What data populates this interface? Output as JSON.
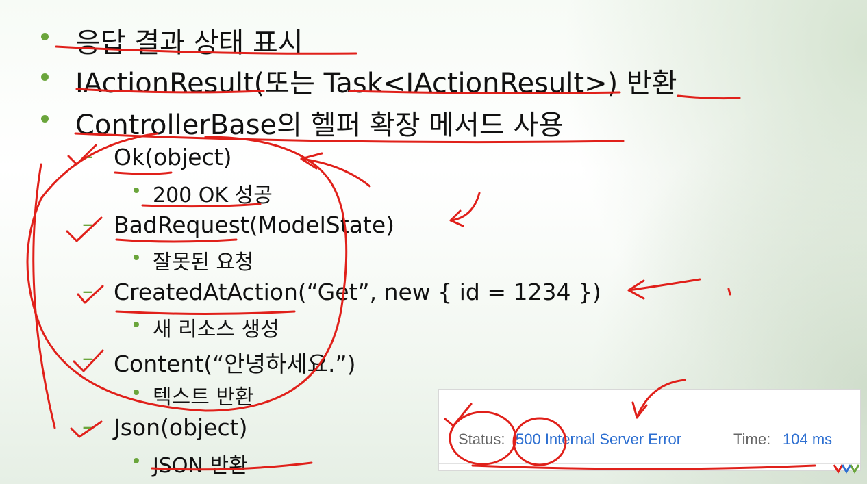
{
  "slide": {
    "bullets": [
      {
        "text": "응답 결과 상태 표시"
      },
      {
        "text": "IActionResult(또는 Task<IActionResult>) 반환"
      },
      {
        "text": "ControllerBase의 헬퍼 확장 메서드 사용"
      }
    ],
    "sub_items": [
      {
        "label": "Ok(object)",
        "desc": "200 OK 성공"
      },
      {
        "label": "BadRequest(ModelState)",
        "desc": "잘못된 요청"
      },
      {
        "label": "CreatedAtAction(“Get”, new { id = 1234 })",
        "desc": "새 리소스 생성"
      },
      {
        "label": "Content(“안녕하세요.”)",
        "desc": "텍스트 반환"
      },
      {
        "label": "Json(object)",
        "desc": "JSON 반환"
      }
    ],
    "dash_glyph": "–"
  },
  "status_panel": {
    "status_label": "Status:",
    "status_value": "500 Internal Server Error",
    "time_label": "Time:",
    "time_value": "104 ms"
  },
  "colors": {
    "bullet": "#6aa53b",
    "annotation": "#e0201a",
    "link": "#2d6fd1"
  },
  "icons": [
    "bullet-dot-icon",
    "dash-icon",
    "brand-logo-icon"
  ]
}
